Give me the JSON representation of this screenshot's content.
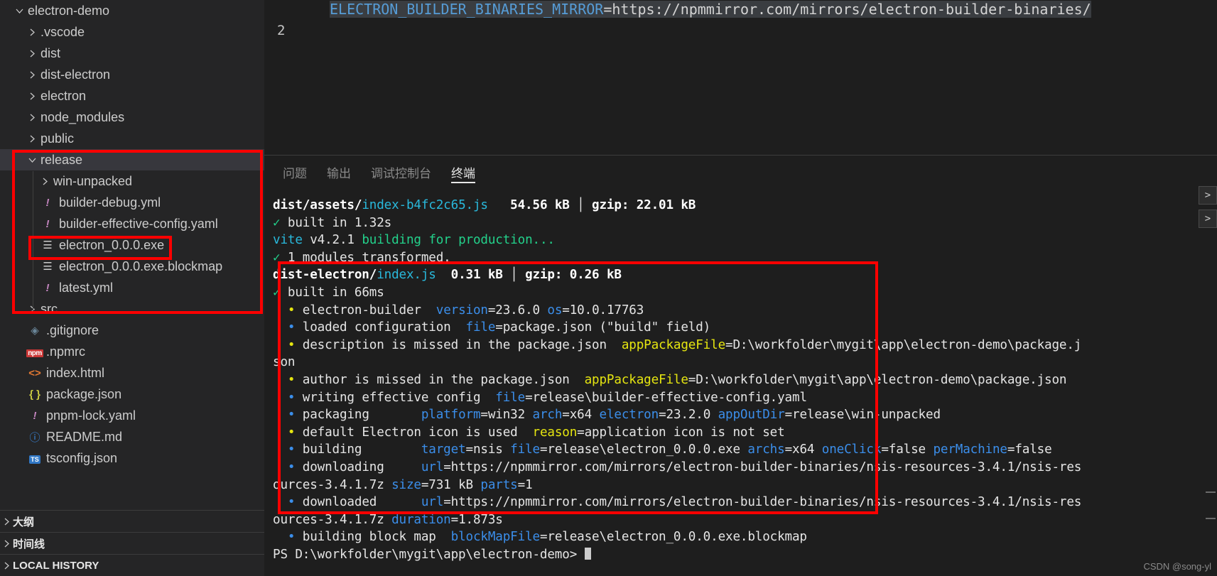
{
  "editor": {
    "line_number": "2",
    "code_segments": [
      {
        "text": "ELECTRON_BUILDER_BINARIES_MIRROR",
        "color": "blue"
      },
      {
        "text": "=",
        "color": "light"
      },
      {
        "text": "https://npmmirror.com/mirrors/electron-builder-binaries/",
        "color": "light"
      }
    ],
    "full_line": "ELECTRON_BUILDER_BINARIES_MIRROR=https://npmmirror.com/mirrors/electron-builder-binaries/"
  },
  "sidebar": {
    "tree": [
      {
        "label": "electron-demo",
        "type": "folder",
        "expanded": true,
        "indent": 0,
        "icon": "chevron-down-icon"
      },
      {
        "label": ".vscode",
        "type": "folder",
        "expanded": false,
        "indent": 1,
        "icon": "chevron-right-icon"
      },
      {
        "label": "dist",
        "type": "folder",
        "expanded": false,
        "indent": 1,
        "icon": "chevron-right-icon"
      },
      {
        "label": "dist-electron",
        "type": "folder",
        "expanded": false,
        "indent": 1,
        "icon": "chevron-right-icon"
      },
      {
        "label": "electron",
        "type": "folder",
        "expanded": false,
        "indent": 1,
        "icon": "chevron-right-icon"
      },
      {
        "label": "node_modules",
        "type": "folder",
        "expanded": false,
        "indent": 1,
        "icon": "chevron-right-icon"
      },
      {
        "label": "public",
        "type": "folder",
        "expanded": false,
        "indent": 1,
        "icon": "chevron-right-icon"
      },
      {
        "label": "release",
        "type": "folder",
        "expanded": true,
        "indent": 1,
        "icon": "chevron-down-icon",
        "selected": true
      },
      {
        "label": "win-unpacked",
        "type": "folder",
        "expanded": false,
        "indent": 2,
        "icon": "chevron-right-icon"
      },
      {
        "label": "builder-debug.yml",
        "type": "file",
        "indent": 2,
        "icon": "yaml-icon"
      },
      {
        "label": "builder-effective-config.yaml",
        "type": "file",
        "indent": 2,
        "icon": "yaml-icon"
      },
      {
        "label": "electron_0.0.0.exe",
        "type": "file",
        "indent": 2,
        "icon": "binary-icon"
      },
      {
        "label": "electron_0.0.0.exe.blockmap",
        "type": "file",
        "indent": 2,
        "icon": "binary-icon"
      },
      {
        "label": "latest.yml",
        "type": "file",
        "indent": 2,
        "icon": "yaml-icon"
      },
      {
        "label": "src",
        "type": "folder",
        "expanded": false,
        "indent": 1,
        "icon": "chevron-right-icon"
      },
      {
        "label": ".gitignore",
        "type": "file",
        "indent": 1,
        "icon": "git-icon"
      },
      {
        "label": ".npmrc",
        "type": "file",
        "indent": 1,
        "icon": "npm-icon"
      },
      {
        "label": "index.html",
        "type": "file",
        "indent": 1,
        "icon": "html-icon"
      },
      {
        "label": "package.json",
        "type": "file",
        "indent": 1,
        "icon": "json-icon"
      },
      {
        "label": "pnpm-lock.yaml",
        "type": "file",
        "indent": 1,
        "icon": "yaml-icon"
      },
      {
        "label": "README.md",
        "type": "file",
        "indent": 1,
        "icon": "markdown-icon"
      },
      {
        "label": "tsconfig.json",
        "type": "file",
        "indent": 1,
        "icon": "typescript-icon"
      }
    ],
    "sections": [
      {
        "label": "大纲",
        "expanded": false
      },
      {
        "label": "时间线",
        "expanded": false
      },
      {
        "label": "LOCAL HISTORY",
        "expanded": false
      }
    ]
  },
  "panel": {
    "tabs": [
      {
        "label": "问题",
        "active": false
      },
      {
        "label": "输出",
        "active": false
      },
      {
        "label": "调试控制台",
        "active": false
      },
      {
        "label": "终端",
        "active": true
      }
    ]
  },
  "terminal": {
    "lines": [
      [
        {
          "t": "dist/assets/",
          "c": "bold"
        },
        {
          "t": "index-b4fc2c65.js",
          "c": "cyan"
        },
        {
          "t": "   ",
          "c": "white"
        },
        {
          "t": "54.56 kB",
          "c": "bold"
        },
        {
          "t": " │ ",
          "c": "white"
        },
        {
          "t": "gzip: 22.01 kB",
          "c": "bold"
        }
      ],
      [
        {
          "t": "✓",
          "c": "green"
        },
        {
          "t": " built in 1.32s",
          "c": "white"
        }
      ],
      [
        {
          "t": "vite",
          "c": "cyan"
        },
        {
          "t": " v4.2.1",
          "c": "white"
        },
        {
          "t": " building for production...",
          "c": "green"
        }
      ],
      [
        {
          "t": "✓",
          "c": "green"
        },
        {
          "t": " 1 modules transformed.",
          "c": "white"
        }
      ],
      [
        {
          "t": "dist-electron/",
          "c": "bold"
        },
        {
          "t": "index.js",
          "c": "cyan"
        },
        {
          "t": "  ",
          "c": "white"
        },
        {
          "t": "0.31 kB",
          "c": "bold"
        },
        {
          "t": " │ ",
          "c": "white"
        },
        {
          "t": "gzip: 0.26 kB",
          "c": "bold"
        }
      ],
      [
        {
          "t": "✓",
          "c": "green"
        },
        {
          "t": " built in 66ms",
          "c": "white"
        }
      ],
      [
        {
          "t": "  • ",
          "c": "yellow"
        },
        {
          "t": "electron-builder  ",
          "c": "white"
        },
        {
          "t": "version",
          "c": "blue"
        },
        {
          "t": "=23.6.0 ",
          "c": "white"
        },
        {
          "t": "os",
          "c": "blue"
        },
        {
          "t": "=10.0.17763",
          "c": "white"
        }
      ],
      [
        {
          "t": "  • ",
          "c": "blue"
        },
        {
          "t": "loaded configuration  ",
          "c": "white"
        },
        {
          "t": "file",
          "c": "blue"
        },
        {
          "t": "=package.json (\"build\" field)",
          "c": "white"
        }
      ],
      [
        {
          "t": "  • ",
          "c": "yellow"
        },
        {
          "t": "description is missed in the package.json  ",
          "c": "white"
        },
        {
          "t": "appPackageFile",
          "c": "yellow"
        },
        {
          "t": "=D:\\workfolder\\mygit\\app\\electron-demo\\package.j",
          "c": "white"
        }
      ],
      [
        {
          "t": "son",
          "c": "white"
        }
      ],
      [
        {
          "t": "  • ",
          "c": "yellow"
        },
        {
          "t": "author is missed in the package.json  ",
          "c": "white"
        },
        {
          "t": "appPackageFile",
          "c": "yellow"
        },
        {
          "t": "=D:\\workfolder\\mygit\\app\\electron-demo\\package.json",
          "c": "white"
        }
      ],
      [
        {
          "t": "  • ",
          "c": "blue"
        },
        {
          "t": "writing effective config  ",
          "c": "white"
        },
        {
          "t": "file",
          "c": "blue"
        },
        {
          "t": "=release\\builder-effective-config.yaml",
          "c": "white"
        }
      ],
      [
        {
          "t": "  • ",
          "c": "blue"
        },
        {
          "t": "packaging       ",
          "c": "white"
        },
        {
          "t": "platform",
          "c": "blue"
        },
        {
          "t": "=win32 ",
          "c": "white"
        },
        {
          "t": "arch",
          "c": "blue"
        },
        {
          "t": "=x64 ",
          "c": "white"
        },
        {
          "t": "electron",
          "c": "blue"
        },
        {
          "t": "=23.2.0 ",
          "c": "white"
        },
        {
          "t": "appOutDir",
          "c": "blue"
        },
        {
          "t": "=release\\win-unpacked",
          "c": "white"
        }
      ],
      [
        {
          "t": "  • ",
          "c": "yellow"
        },
        {
          "t": "default Electron icon is used  ",
          "c": "white"
        },
        {
          "t": "reason",
          "c": "yellow"
        },
        {
          "t": "=application icon is not set",
          "c": "white"
        }
      ],
      [
        {
          "t": "  • ",
          "c": "blue"
        },
        {
          "t": "building        ",
          "c": "white"
        },
        {
          "t": "target",
          "c": "blue"
        },
        {
          "t": "=nsis ",
          "c": "white"
        },
        {
          "t": "file",
          "c": "blue"
        },
        {
          "t": "=release\\electron_0.0.0.exe ",
          "c": "white"
        },
        {
          "t": "archs",
          "c": "blue"
        },
        {
          "t": "=x64 ",
          "c": "white"
        },
        {
          "t": "oneClick",
          "c": "blue"
        },
        {
          "t": "=false ",
          "c": "white"
        },
        {
          "t": "perMachine",
          "c": "blue"
        },
        {
          "t": "=false",
          "c": "white"
        }
      ],
      [
        {
          "t": "  • ",
          "c": "blue"
        },
        {
          "t": "downloading     ",
          "c": "white"
        },
        {
          "t": "url",
          "c": "blue"
        },
        {
          "t": "=https://npmmirror.com/mirrors/electron-builder-binaries/nsis-resources-3.4.1/nsis-res",
          "c": "white"
        }
      ],
      [
        {
          "t": "ources-3.4.1.7z ",
          "c": "white"
        },
        {
          "t": "size",
          "c": "blue"
        },
        {
          "t": "=731 kB ",
          "c": "white"
        },
        {
          "t": "parts",
          "c": "blue"
        },
        {
          "t": "=1",
          "c": "white"
        }
      ],
      [
        {
          "t": "  • ",
          "c": "blue"
        },
        {
          "t": "downloaded      ",
          "c": "white"
        },
        {
          "t": "url",
          "c": "blue"
        },
        {
          "t": "=https://npmmirror.com/mirrors/electron-builder-binaries/nsis-resources-3.4.1/nsis-res",
          "c": "white"
        }
      ],
      [
        {
          "t": "ources-3.4.1.7z ",
          "c": "white"
        },
        {
          "t": "duration",
          "c": "blue"
        },
        {
          "t": "=1.873s",
          "c": "white"
        }
      ],
      [
        {
          "t": "  • ",
          "c": "blue"
        },
        {
          "t": "building block map  ",
          "c": "white"
        },
        {
          "t": "blockMapFile",
          "c": "blue"
        },
        {
          "t": "=release\\electron_0.0.0.exe.blockmap",
          "c": "white"
        }
      ],
      [
        {
          "t": "PS D:\\workfolder\\mygit\\app\\electron-demo> ",
          "c": "white"
        }
      ]
    ],
    "prompt_cursor": true
  },
  "edge_buttons": [
    {
      "label": ">",
      "name": "panel-maximize-button"
    },
    {
      "label": ">",
      "name": "panel-expand-button"
    }
  ],
  "watermark": "CSDN @song-yl",
  "colors": {
    "annotation": "#ff0000",
    "accent_cyan": "#29b8db",
    "accent_green": "#23d18b",
    "accent_yellow": "#e5e510",
    "accent_blue": "#3b8eea",
    "sidebar_bg": "#252526",
    "editor_bg": "#1e1e1e",
    "selection_bg": "#37373d"
  }
}
